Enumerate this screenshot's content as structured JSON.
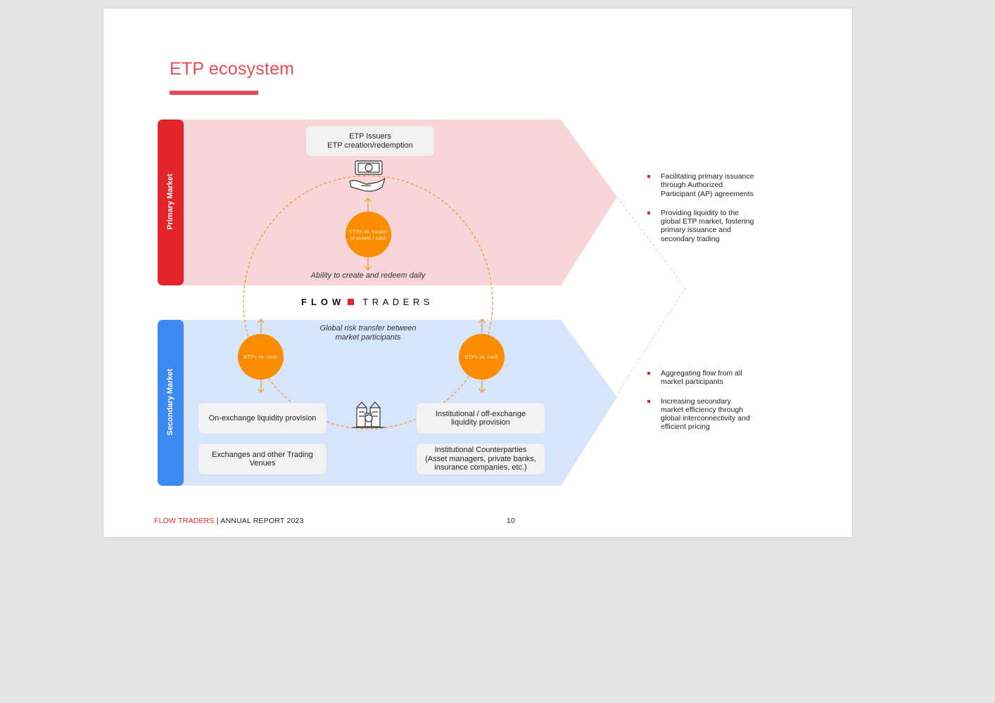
{
  "page": {
    "title": "ETP ecosystem",
    "footer_brand": "FLOW TRADERS",
    "footer_separator": " | ",
    "footer_report": "ANNUAL REPORT 2023",
    "page_number": "10"
  },
  "diagram": {
    "primary_label": "Primary Market",
    "secondary_label": "Secondary Market",
    "primary_color": "#e3242b",
    "secondary_color": "#3b8af2",
    "primary_band_color": "#f8d5d6",
    "secondary_band_color": "#d7e5fb",
    "accent_orange": "#fb8c00",
    "issuers_box": "ETP Issuers\nETP creation/redemption",
    "primary_circle": "ETPs vs. basket\nof assets / cash",
    "primary_caption": "Ability to create and redeem daily",
    "brand_flow": "FLOW",
    "brand_traders": "TRADERS",
    "secondary_caption": "Global risk transfer between\nmarket participants",
    "left_circle": "ETPs vs. cash",
    "right_circle": "ETPs vs. cash",
    "boxes": {
      "on_exchange": "On-exchange liquidity provision",
      "exchanges": "Exchanges and other Trading\nVenues",
      "institutional": "Institutional / off-exchange\nliquidity provision",
      "counterparties": "Institutional Counterparties\n(Asset managers, private banks,\ninsurance companies, etc.)"
    },
    "icons": {
      "issuer_icon": "hand-holding-money-icon",
      "market_icon": "bank-building-icon"
    }
  },
  "bullets": {
    "primary": [
      "Facilitating primary issuance\nthrough Authorized\nParticipant (AP) agreements",
      "Providing liquidity to the\nglobal ETP market, fostering\nprimary issuance and\nsecondary trading"
    ],
    "secondary": [
      "Aggregating flow from all\nmarket participants",
      "Increasing secondary\nmarket efficiency through\nglobal interconnectivity and\nefficient pricing"
    ]
  }
}
